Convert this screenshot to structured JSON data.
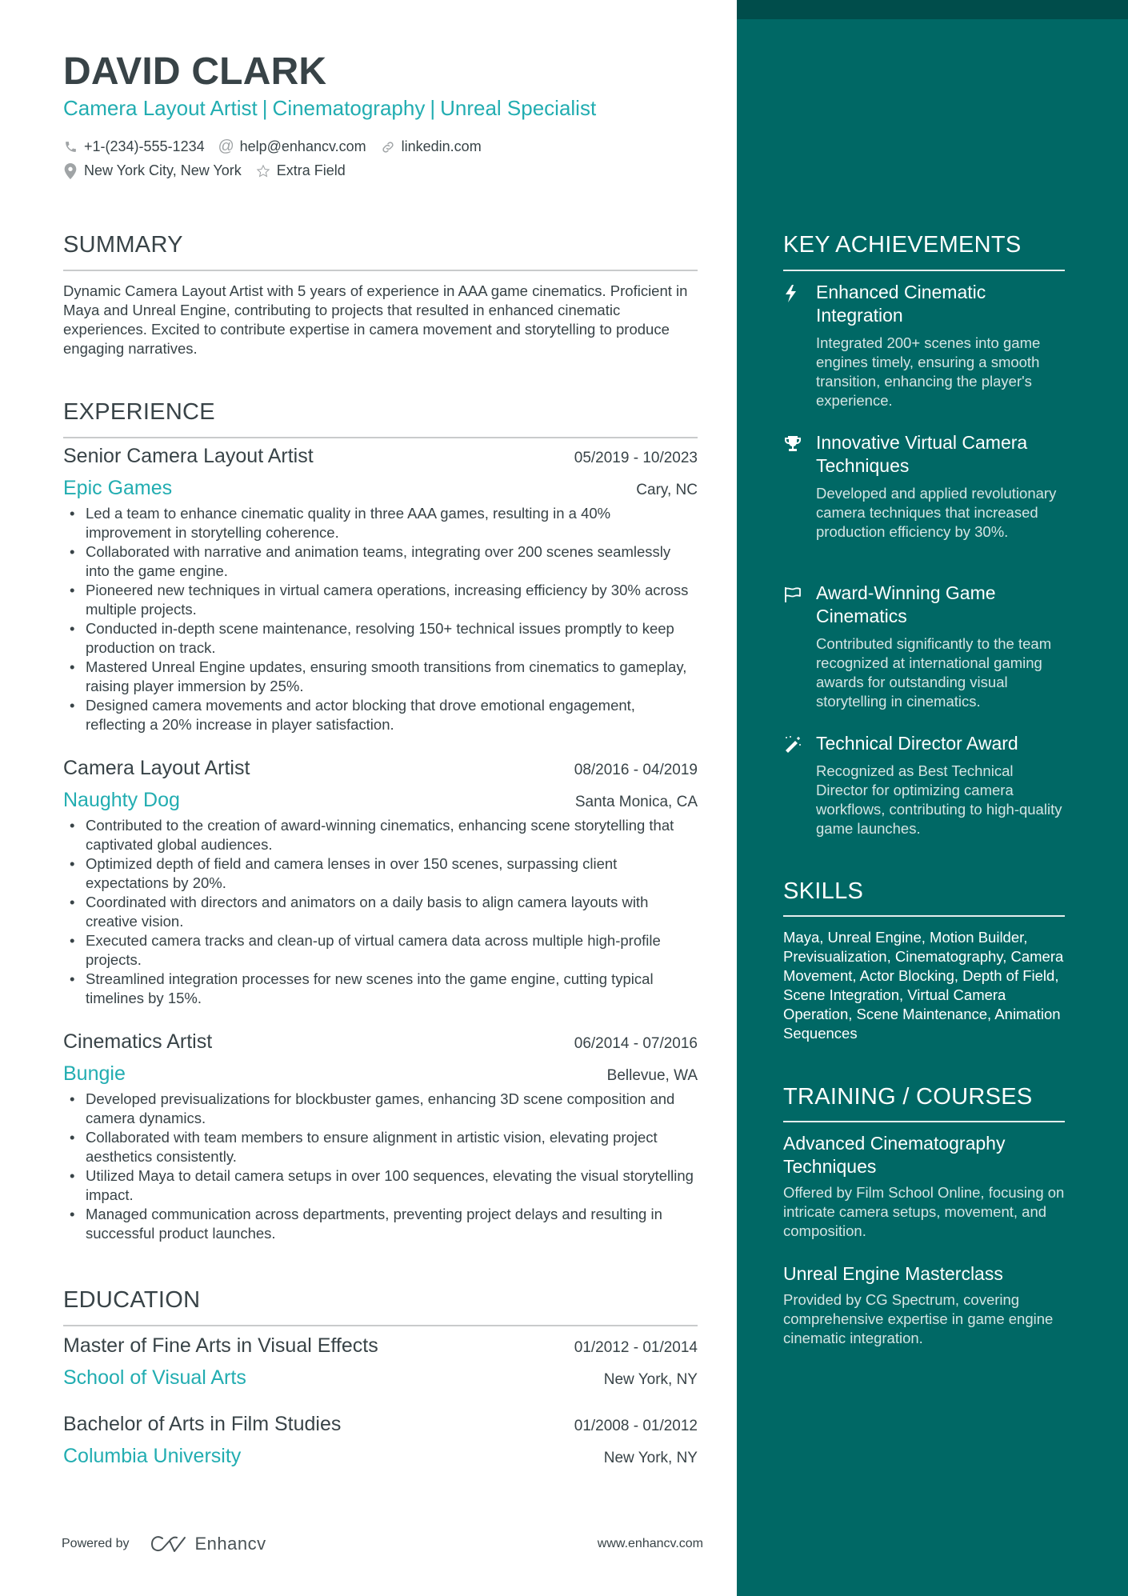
{
  "colors": {
    "accent": "#22adb1",
    "sidebar": "#006865",
    "sidebar_band": "#004d4b",
    "text": "#384347"
  },
  "header": {
    "name": "DAVID CLARK",
    "headline": [
      "Camera Layout Artist",
      "Cinematography",
      "Unreal Specialist"
    ],
    "headline_separator": "|",
    "contacts": {
      "phone": {
        "icon": "phone-icon",
        "text": "+1-(234)-555-1234"
      },
      "email": {
        "icon": "at-icon",
        "text": "help@enhancv.com"
      },
      "link": {
        "icon": "link-icon",
        "text": "linkedin.com"
      },
      "location": {
        "icon": "location-pin-icon",
        "text": "New York City, New York"
      },
      "extra": {
        "icon": "star-icon",
        "text": "Extra Field"
      }
    }
  },
  "summary": {
    "title": "SUMMARY",
    "text": "Dynamic Camera Layout Artist with 5 years of experience in AAA game cinematics. Proficient in Maya and Unreal Engine, contributing to projects that resulted in enhanced cinematic experiences. Excited to contribute expertise in camera movement and storytelling to produce engaging narratives."
  },
  "experience": {
    "title": "EXPERIENCE",
    "jobs": [
      {
        "title": "Senior Camera Layout Artist",
        "dates": "05/2019 - 10/2023",
        "company": "Epic Games",
        "location": "Cary, NC",
        "bullets": [
          "Led a team to enhance cinematic quality in three AAA games, resulting in a 40% improvement in storytelling coherence.",
          "Collaborated with narrative and animation teams, integrating over 200 scenes seamlessly into the game engine.",
          "Pioneered new techniques in virtual camera operations, increasing efficiency by 30% across multiple projects.",
          "Conducted in-depth scene maintenance, resolving 150+ technical issues promptly to keep production on track.",
          "Mastered Unreal Engine updates, ensuring smooth transitions from cinematics to gameplay, raising player immersion by 25%.",
          "Designed camera movements and actor blocking that drove emotional engagement, reflecting a 20% increase in player satisfaction."
        ]
      },
      {
        "title": "Camera Layout Artist",
        "dates": "08/2016 - 04/2019",
        "company": "Naughty Dog",
        "location": "Santa Monica, CA",
        "bullets": [
          "Contributed to the creation of award-winning cinematics, enhancing scene storytelling that captivated global audiences.",
          "Optimized depth of field and camera lenses in over 150 scenes, surpassing client expectations by 20%.",
          "Coordinated with directors and animators on a daily basis to align camera layouts with creative vision.",
          "Executed camera tracks and clean-up of virtual camera data across multiple high-profile projects.",
          "Streamlined integration processes for new scenes into the game engine, cutting typical timelines by 15%."
        ]
      },
      {
        "title": "Cinematics Artist",
        "dates": "06/2014 - 07/2016",
        "company": "Bungie",
        "location": "Bellevue, WA",
        "bullets": [
          "Developed previsualizations for blockbuster games, enhancing 3D scene composition and camera dynamics.",
          "Collaborated with team members to ensure alignment in artistic vision, elevating project aesthetics consistently.",
          "Utilized Maya to detail camera setups in over 100 sequences, elevating the visual storytelling impact.",
          "Managed communication across departments, preventing project delays and resulting in successful product launches."
        ]
      }
    ]
  },
  "education": {
    "title": "EDUCATION",
    "items": [
      {
        "degree": "Master of Fine Arts in Visual Effects",
        "dates": "01/2012 - 01/2014",
        "school": "School of Visual Arts",
        "location": "New York, NY"
      },
      {
        "degree": "Bachelor of Arts in Film Studies",
        "dates": "01/2008 - 01/2012",
        "school": "Columbia University",
        "location": "New York, NY"
      }
    ]
  },
  "achievements": {
    "title": "KEY ACHIEVEMENTS",
    "items": [
      {
        "icon": "lightning-bolt-icon",
        "title": "Enhanced Cinematic Integration",
        "desc": "Integrated 200+ scenes into game engines timely, ensuring a smooth transition, enhancing the player's experience."
      },
      {
        "icon": "trophy-icon",
        "title": "Innovative Virtual Camera Techniques",
        "desc": "Developed and applied revolutionary camera techniques that increased production efficiency by 30%."
      },
      {
        "icon": "flag-icon",
        "title": "Award-Winning Game Cinematics",
        "desc": "Contributed significantly to the team recognized at international gaming awards for outstanding visual storytelling in cinematics."
      },
      {
        "icon": "magic-wand-icon",
        "title": "Technical Director Award",
        "desc": "Recognized as Best Technical Director for optimizing camera workflows, contributing to high-quality game launches."
      }
    ]
  },
  "skills": {
    "title": "SKILLS",
    "text": "Maya, Unreal Engine, Motion Builder, Previsualization, Cinematography, Camera Movement, Actor Blocking, Depth of Field, Scene Integration, Virtual Camera Operation, Scene Maintenance, Animation Sequences"
  },
  "training": {
    "title": "TRAINING / COURSES",
    "items": [
      {
        "title": "Advanced Cinematography Techniques",
        "desc": "Offered by Film School Online, focusing on intricate camera setups, movement, and composition."
      },
      {
        "title": "Unreal Engine Masterclass",
        "desc": "Provided by CG Spectrum, covering comprehensive expertise in game engine cinematic integration."
      }
    ]
  },
  "footer": {
    "powered_by": "Powered by",
    "brand": "Enhancv",
    "website": "www.enhancv.com"
  }
}
